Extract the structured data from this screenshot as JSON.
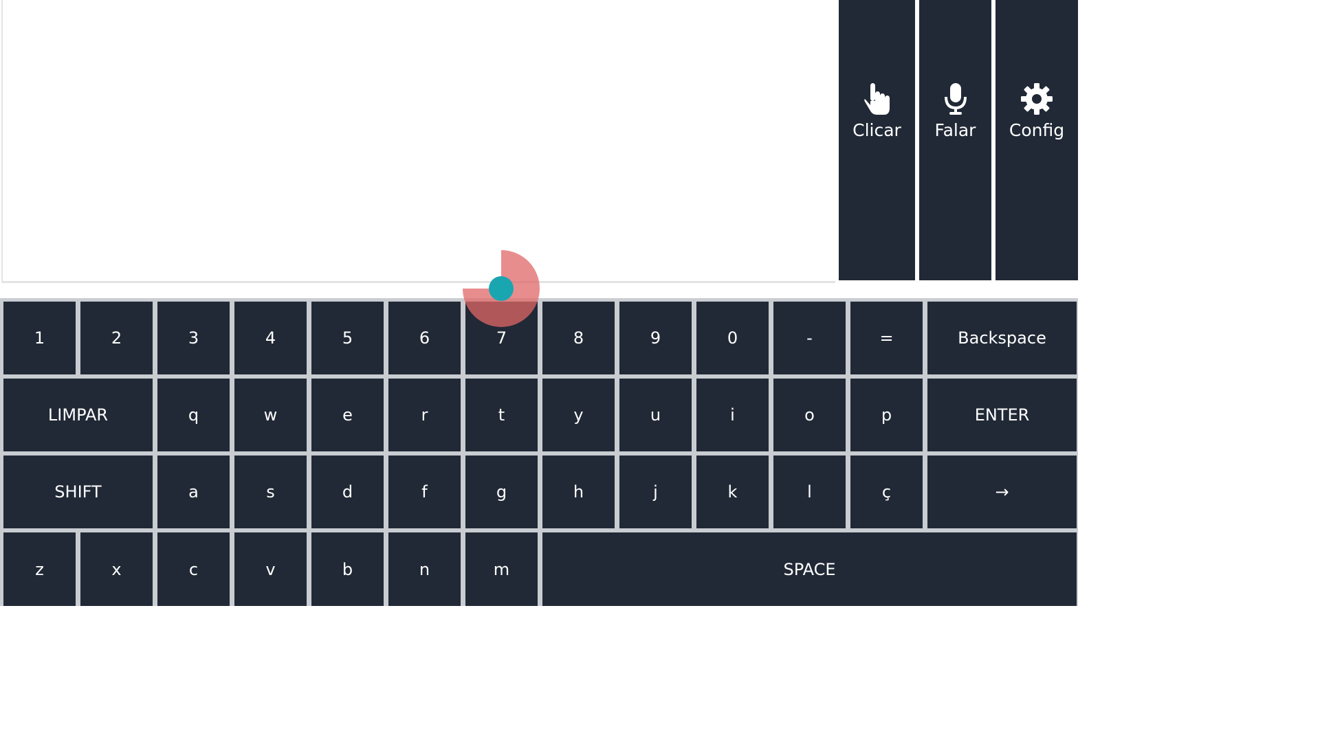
{
  "actions": {
    "click_label": "Clicar",
    "speak_label": "Falar",
    "config_label": "Config",
    "click_icon": "hand-pointer-icon",
    "speak_icon": "microphone-icon",
    "config_icon": "gear-icon"
  },
  "text_area": {
    "value": ""
  },
  "keyboard": {
    "rows": [
      [
        "1",
        "2",
        "3",
        "4",
        "5",
        "6",
        "7",
        "8",
        "9",
        "0",
        "-",
        "=",
        "Backspace"
      ],
      [
        "LIMPAR",
        "q",
        "w",
        "e",
        "r",
        "t",
        "y",
        "u",
        "i",
        "o",
        "p",
        "ENTER"
      ],
      [
        "SHIFT",
        "a",
        "s",
        "d",
        "f",
        "g",
        "h",
        "j",
        "k",
        "l",
        "ç",
        "→"
      ],
      [
        "z",
        "x",
        "c",
        "v",
        "b",
        "n",
        "m",
        "SPACE"
      ]
    ]
  },
  "gaze": {
    "dwell_progress": 0.75
  },
  "colors": {
    "key_bg": "#212936",
    "key_text": "#ffffff",
    "gaze_ring": "#e06767",
    "gaze_dot": "#19a6b0"
  }
}
